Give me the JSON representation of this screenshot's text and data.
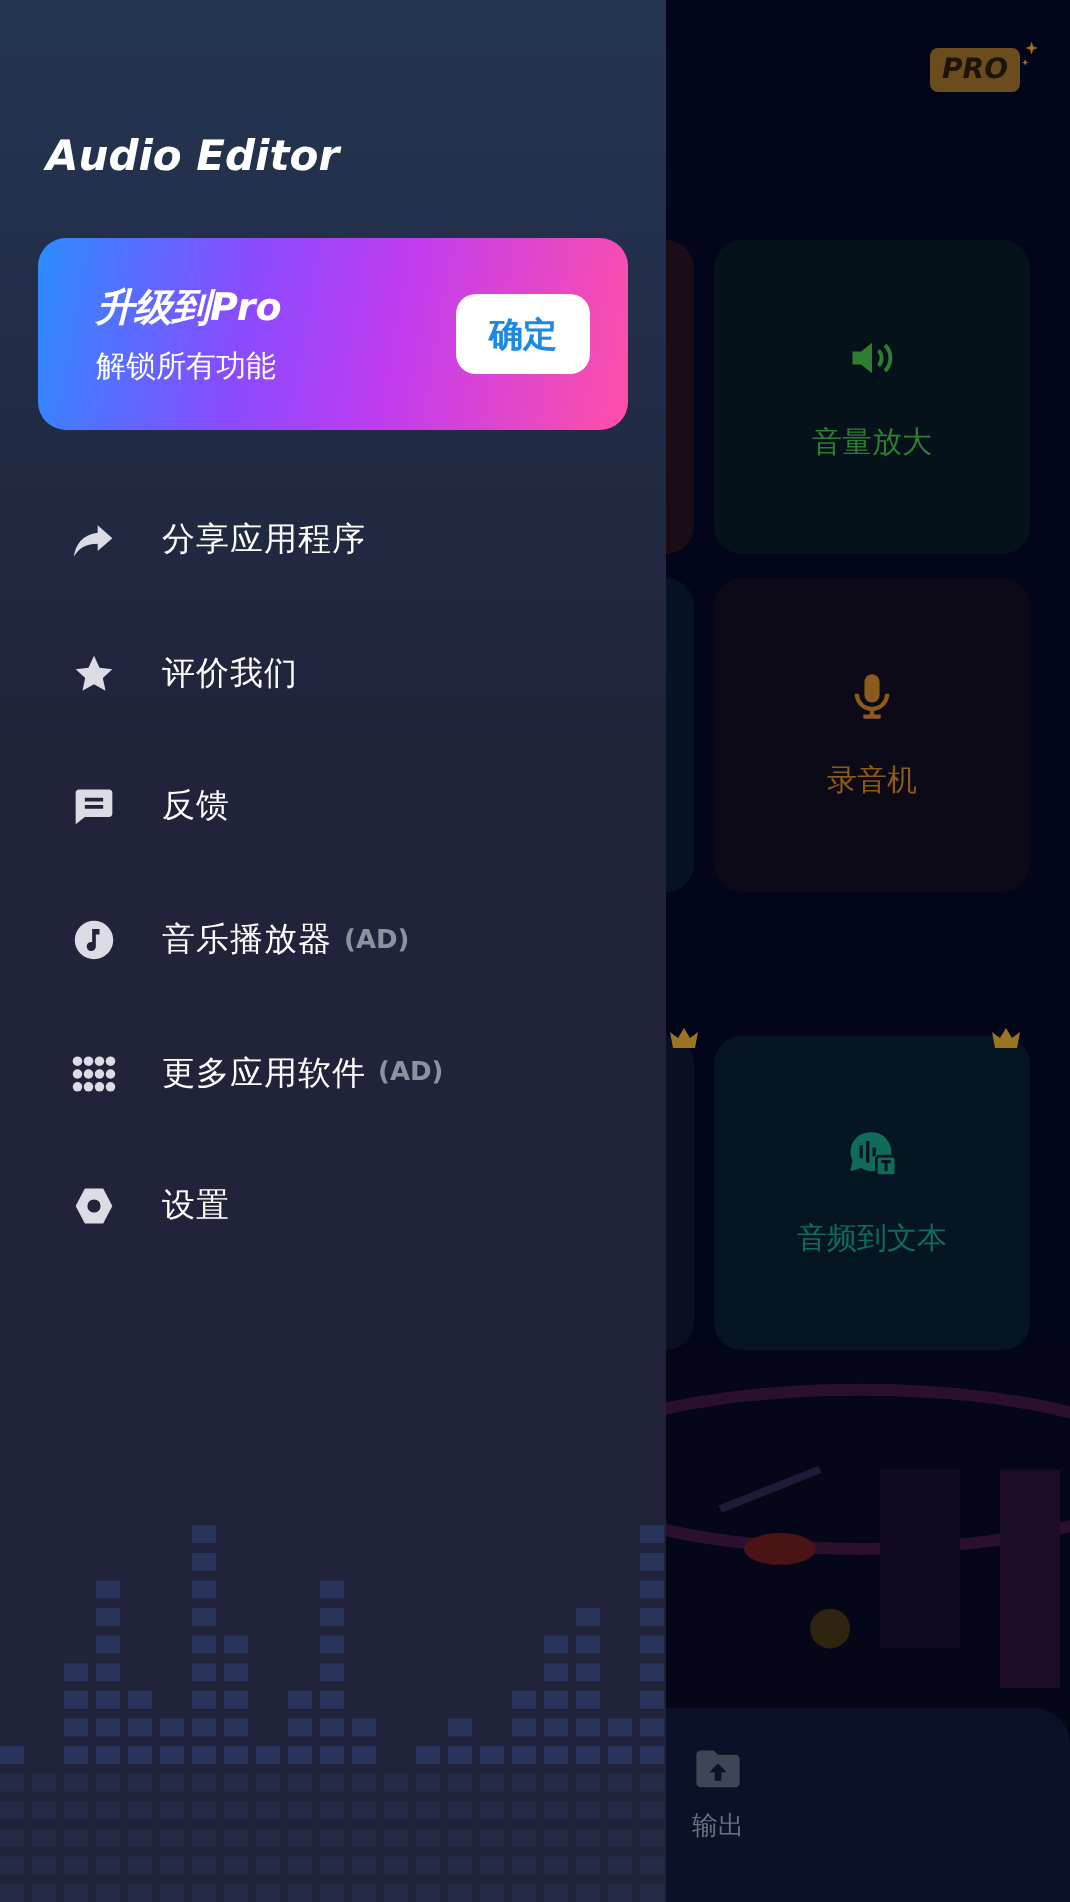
{
  "app_bar": {
    "pro_badge": "PRO"
  },
  "tools": [
    {
      "label": "音量放大",
      "color": "#2e7d32",
      "crown": false
    },
    {
      "label": "录音机",
      "color": "#8a5a1e",
      "crown": false
    },
    {
      "label": "音频到文本",
      "color": "#0f6b5a",
      "crown": true
    }
  ],
  "bottom_nav": [
    {
      "label": "输出"
    }
  ],
  "drawer": {
    "title": "Audio Editor",
    "promo": {
      "title": "升级到Pro",
      "subtitle": "解锁所有功能",
      "button": "确定"
    },
    "items": [
      {
        "label": "分享应用程序"
      },
      {
        "label": "评价我们"
      },
      {
        "label": "反馈"
      },
      {
        "label": "音乐播放器",
        "tag": "(AD)"
      },
      {
        "label": "更多应用软件",
        "tag": "(AD)"
      },
      {
        "label": "设置"
      }
    ]
  }
}
